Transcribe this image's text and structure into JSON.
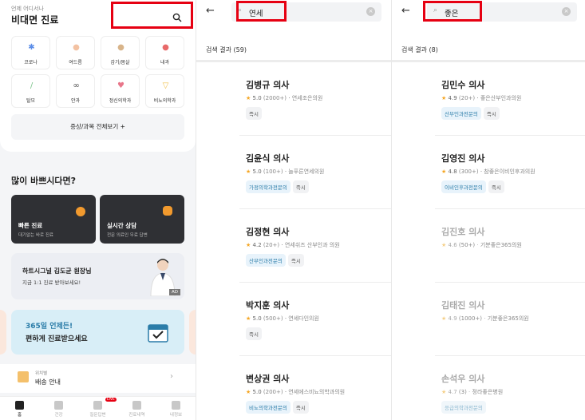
{
  "home": {
    "subtitle": "언제 어디서나",
    "title": "비대면 진료",
    "categories": [
      {
        "label": "코로나",
        "icon": "virus-icon",
        "color": "#5b8de8",
        "glyph": "✱"
      },
      {
        "label": "여드름",
        "icon": "face-icon",
        "color": "#f3c2a2",
        "glyph": "●"
      },
      {
        "label": "감기/몸살",
        "icon": "cold-icon",
        "color": "#d8b48a",
        "glyph": "●"
      },
      {
        "label": "내과",
        "icon": "lungs-icon",
        "color": "#e86a6a",
        "glyph": "●"
      },
      {
        "label": "탈모",
        "icon": "hair-icon",
        "color": "#7cc48b",
        "glyph": "/"
      },
      {
        "label": "안과",
        "icon": "eye-glasses-icon",
        "color": "#555555",
        "glyph": "∞"
      },
      {
        "label": "정신의학과",
        "icon": "heart-head-icon",
        "color": "#e8768a",
        "glyph": "♥"
      },
      {
        "label": "비뇨의학과",
        "icon": "urology-icon",
        "color": "#f2c14e",
        "glyph": "▽"
      }
    ],
    "all_button": "증상/과목 전체보기  +",
    "section_title": "많이 바쁘시다면?",
    "quick": [
      {
        "title": "빠른 진료",
        "desc": "대기없는 바로 진료",
        "icon": "orange-clock-icon",
        "color": "#f29a2e"
      },
      {
        "title": "실시간 상담",
        "desc": "전문 의료인 무료 답변",
        "icon": "chat-bubble-icon",
        "color": "#f29a2e"
      }
    ],
    "banner_doctor": {
      "line1": "하트시그널 김도균 원장님",
      "line2": "지금 1:1 진료 받아보세요!",
      "ad": "AD"
    },
    "banner_365": {
      "line1": "365일 언제든!",
      "line2": "편하게 진료받으세요"
    },
    "delivery": {
      "label": "위치별",
      "title": "배송 안내"
    },
    "tabs": [
      {
        "label": "홈",
        "icon": "home-icon",
        "active": true
      },
      {
        "label": "건강",
        "icon": "health-icon",
        "active": false
      },
      {
        "label": "질문답변",
        "icon": "qna-icon",
        "active": false,
        "badge": "LIVE"
      },
      {
        "label": "진료내역",
        "icon": "history-icon",
        "active": false
      },
      {
        "label": "내정보",
        "icon": "profile-icon",
        "active": false
      }
    ]
  },
  "search1": {
    "query": "연세",
    "result_label": "검색 결과 (59)",
    "doctors": [
      {
        "name": "김병규 의사",
        "rating": "5.0",
        "count": "(2000+)",
        "hospital": "연세조은의원",
        "tags": [
          "즉시"
        ],
        "blue": [
          false
        ],
        "dim": false
      },
      {
        "name": "김윤식 의사",
        "rating": "5.0",
        "count": "(100+)",
        "hospital": "늘푸른연세의원",
        "tags": [
          "가정의학과전문의",
          "즉시"
        ],
        "blue": [
          true,
          false
        ],
        "dim": false
      },
      {
        "name": "김정현 의사",
        "rating": "4.2",
        "count": "(20+)",
        "hospital": "연세쉬즈 산부인과 의원",
        "tags": [
          "산부인과전문의",
          "즉시"
        ],
        "blue": [
          true,
          false
        ],
        "dim": false
      },
      {
        "name": "박지훈 의사",
        "rating": "5.0",
        "count": "(500+)",
        "hospital": "연세다인의원",
        "tags": [
          "즉시"
        ],
        "blue": [
          false
        ],
        "dim": false
      },
      {
        "name": "변상권 의사",
        "rating": "5.0",
        "count": "(200+)",
        "hospital": "연세에스비뇨의학과의원",
        "tags": [
          "비뇨의학과전문의",
          "즉시"
        ],
        "blue": [
          true,
          false
        ],
        "dim": false
      }
    ]
  },
  "search2": {
    "query": "좋은",
    "result_label": "검색 결과 (8)",
    "doctors": [
      {
        "name": "김민수 의사",
        "rating": "4.9",
        "count": "(20+)",
        "hospital": "좋은산부인과의원",
        "tags": [
          "산부인과전문의",
          "즉시"
        ],
        "blue": [
          true,
          false
        ],
        "dim": false
      },
      {
        "name": "김영진 의사",
        "rating": "4.8",
        "count": "(300+)",
        "hospital": "참좋은이비인후과의원",
        "tags": [
          "이비인후과전문의",
          "즉시"
        ],
        "blue": [
          true,
          false
        ],
        "dim": false
      },
      {
        "name": "김진호 의사",
        "rating": "4.6",
        "count": "(50+)",
        "hospital": "기분좋은365의원",
        "tags": [],
        "blue": [],
        "dim": true
      },
      {
        "name": "김태진 의사",
        "rating": "4.9",
        "count": "(1000+)",
        "hospital": "기분좋은365의원",
        "tags": [],
        "blue": [],
        "dim": true
      },
      {
        "name": "손석우 의사",
        "rating": "4.7",
        "count": "(3)",
        "hospital": "정라좋은병원",
        "tags": [
          "응급의학과전문의"
        ],
        "blue": [
          true
        ],
        "dim": true
      }
    ]
  },
  "colors": {
    "highlight": "#e60012",
    "accent": "#2a7ca8",
    "star": "#f5a623"
  }
}
